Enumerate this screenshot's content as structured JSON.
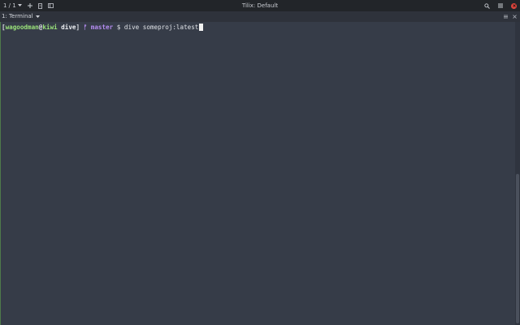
{
  "titlebar": {
    "session_counter": "1 / 1",
    "title": "Tilix: Default"
  },
  "tab": {
    "label": "1: Terminal"
  },
  "terminal": {
    "prompt_open": "[",
    "user": "wagoodman",
    "at": "@",
    "host": "kiwi",
    "dir": " dive",
    "prompt_close": "] ",
    "branch_icon": "ᚠ",
    "branch": " master",
    "prompt_symbol": " $ ",
    "command": "dive someproj:latest"
  },
  "colors": {
    "background": "#363c48",
    "titlebar": "#222529",
    "user_host": "#9ae27a",
    "branch": "#b48cf0",
    "close_button": "#e0463d"
  }
}
